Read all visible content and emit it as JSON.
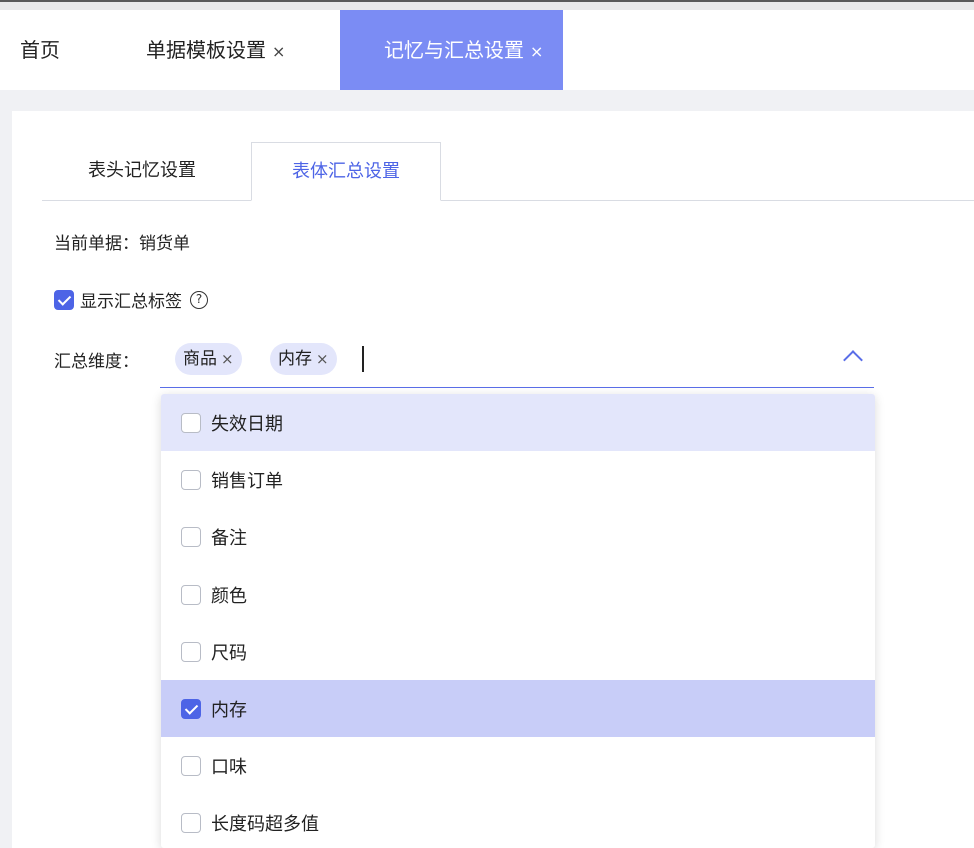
{
  "tabs": [
    {
      "label": "首页",
      "closable": false
    },
    {
      "label": "单据模板设置",
      "closable": true
    },
    {
      "label": "记忆与汇总设置",
      "closable": true,
      "active": true
    }
  ],
  "close_glyph": "×",
  "subtabs": [
    {
      "label": "表头记忆设置"
    },
    {
      "label": "表体汇总设置",
      "active": true
    }
  ],
  "current_doc": "当前单据：销货单",
  "show_summary": {
    "label": "显示汇总标签",
    "checked": true,
    "help_icon": "question-circle-icon",
    "help_glyph": "?"
  },
  "dimension": {
    "label": "汇总维度：",
    "chips": [
      "商品",
      "内存"
    ],
    "expanded": true
  },
  "options": [
    {
      "label": "失效日期",
      "checked": false,
      "highlighted": true
    },
    {
      "label": "销售订单",
      "checked": false
    },
    {
      "label": "备注",
      "checked": false
    },
    {
      "label": "颜色",
      "checked": false
    },
    {
      "label": "尺码",
      "checked": false
    },
    {
      "label": "内存",
      "checked": true
    },
    {
      "label": "口味",
      "checked": false
    },
    {
      "label": "长度码超多值",
      "checked": false
    }
  ],
  "colors": {
    "accent": "#4d64e6",
    "active_tab": "#7b8cf4",
    "chip_bg": "#e3e6fb",
    "selected_row": "#c8cdf8"
  }
}
